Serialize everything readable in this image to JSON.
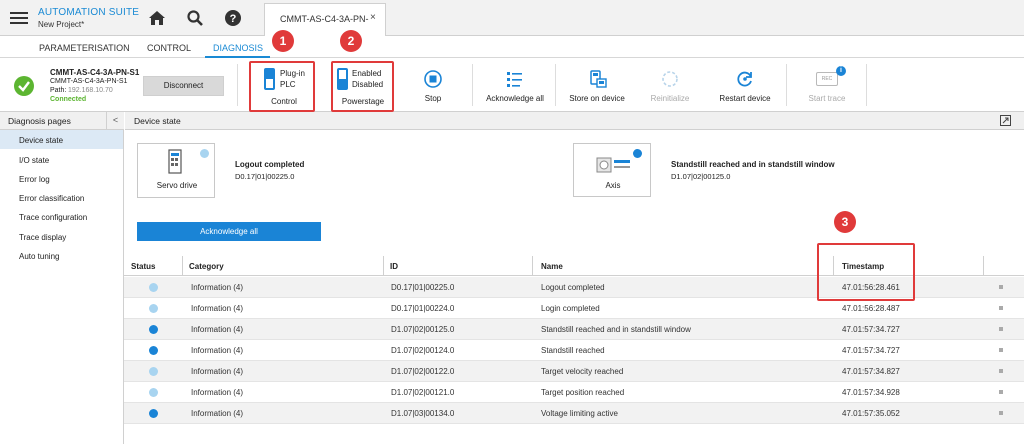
{
  "app": {
    "title": "AUTOMATION SUITE",
    "project": "New Project*"
  },
  "doc_tab": {
    "label": "CMMT-AS-C4-3A-PN-",
    "close": "×"
  },
  "nav": {
    "tabs": [
      "PARAMETERISATION",
      "CONTROL",
      "DIAGNOSIS"
    ],
    "active": "DIAGNOSIS"
  },
  "device": {
    "name": "CMMT-AS-C4-3A-PN-S1",
    "sub": "CMMT-AS-C4-3A-PN-S1",
    "path_label": "Path:",
    "path_value": "192.168.10.70",
    "status": "Connected",
    "disconnect": "Disconnect"
  },
  "toolbar": {
    "control": {
      "line1": "Plug-in",
      "line2": "PLC",
      "label": "Control"
    },
    "powerstage": {
      "line1": "Enabled",
      "line2": "Disabled",
      "label": "Powerstage"
    },
    "stop": "Stop",
    "acknowledge_all": "Acknowledge all",
    "store": "Store on device",
    "reinitialize": "Reinitialize",
    "restart": "Restart device",
    "start_trace": "Start trace",
    "rec": "REC",
    "info": "i"
  },
  "badges": [
    "1",
    "2",
    "3"
  ],
  "sidebar": {
    "title": "Diagnosis pages",
    "collapse": "<",
    "items": [
      "Device state",
      "I/O state",
      "Error log",
      "Error classification",
      "Trace configuration",
      "Trace display",
      "Auto tuning"
    ],
    "active": "Device state"
  },
  "main": {
    "title": "Device state",
    "servo": {
      "label": "Servo drive",
      "message": "Logout completed",
      "id": "D0.17|01|00225.0"
    },
    "axis": {
      "label": "Axis",
      "message": "Standstill reached and in standstill window",
      "id": "D1.07|02|00125.0"
    },
    "ack_button": "Acknowledge all"
  },
  "table": {
    "headers": [
      "Status",
      "Category",
      "ID",
      "Name",
      "Timestamp"
    ],
    "rows": [
      {
        "status": "light",
        "category": "Information (4)",
        "id": "D0.17|01|00225.0",
        "name": "Logout completed",
        "timestamp": "47.01:56:28.461"
      },
      {
        "status": "light",
        "category": "Information (4)",
        "id": "D0.17|01|00224.0",
        "name": "Login completed",
        "timestamp": "47.01:56:28.487"
      },
      {
        "status": "dark",
        "category": "Information (4)",
        "id": "D1.07|02|00125.0",
        "name": "Standstill reached and in standstill window",
        "timestamp": "47.01:57:34.727"
      },
      {
        "status": "dark",
        "category": "Information (4)",
        "id": "D1.07|02|00124.0",
        "name": "Standstill reached",
        "timestamp": "47.01:57:34.727"
      },
      {
        "status": "light",
        "category": "Information (4)",
        "id": "D1.07|02|00122.0",
        "name": "Target velocity reached",
        "timestamp": "47.01:57:34.827"
      },
      {
        "status": "light",
        "category": "Information (4)",
        "id": "D1.07|02|00121.0",
        "name": "Target position reached",
        "timestamp": "47.01:57:34.928"
      },
      {
        "status": "dark",
        "category": "Information (4)",
        "id": "D1.07|03|00134.0",
        "name": "Voltage limiting active",
        "timestamp": "47.01:57:35.052"
      }
    ]
  },
  "colors": {
    "accent": "#1a8ad4",
    "connected": "#5cb531",
    "dot_light": "#a8d4f0",
    "dot_dark": "#1a84d6",
    "highlight": "#e03a3a"
  }
}
